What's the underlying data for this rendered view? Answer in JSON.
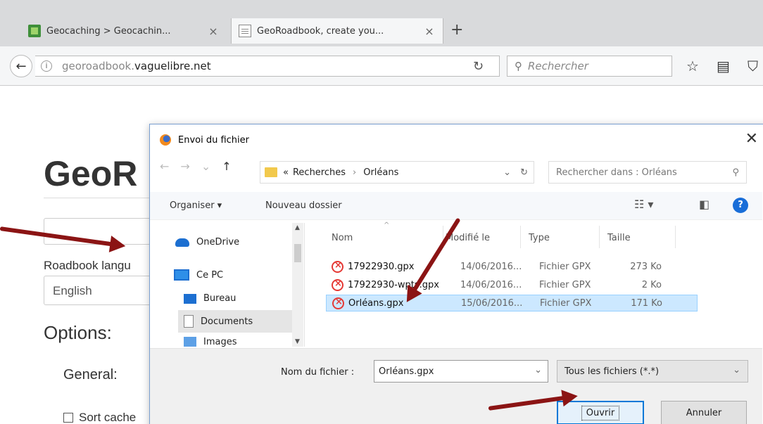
{
  "browser": {
    "tabs": [
      {
        "title": "Geocaching > Geocachin...",
        "favicon": "geocaching-icon"
      },
      {
        "title": "GeoRoadbook, create you...",
        "favicon": "document-icon"
      }
    ],
    "new_tab": "+",
    "url_prefix": "georoadbook.",
    "url_domain": "vaguelibre.net",
    "search_placeholder": "Rechercher"
  },
  "page": {
    "title": "GeoR",
    "roadbook_label": "Roadbook langu",
    "language_value": "English",
    "options_heading": "Options:",
    "general_heading": "General:",
    "sort_label": "Sort cache"
  },
  "dialog": {
    "title": "Envoi du fichier",
    "path": {
      "prefix": "«",
      "parts": [
        "Recherches",
        "Orléans"
      ]
    },
    "search_placeholder": "Rechercher dans : Orléans",
    "organize_label": "Organiser ▾",
    "new_folder_label": "Nouveau dossier",
    "nav_items": [
      "OneDrive",
      "Ce PC",
      "Bureau",
      "Documents",
      "Images"
    ],
    "columns": [
      "Nom",
      "Modifié le",
      "Type",
      "Taille"
    ],
    "files": [
      {
        "name": "17922930.gpx",
        "date": "14/06/2016...",
        "type": "Fichier GPX",
        "size": "273 Ko"
      },
      {
        "name": "17922930-wpts.gpx",
        "date": "14/06/2016...",
        "type": "Fichier GPX",
        "size": "2 Ko"
      },
      {
        "name": "Orléans.gpx",
        "date": "15/06/2016...",
        "type": "Fichier GPX",
        "size": "171 Ko"
      }
    ],
    "filename_label": "Nom du fichier :",
    "filename_value": "Orléans.gpx",
    "filter_value": "Tous les fichiers (*.*)",
    "open_label": "Ouvrir",
    "cancel_label": "Annuler"
  },
  "colors": {
    "arrow": "#8b1414",
    "selection": "#cce8ff",
    "accent": "#0078d7"
  }
}
